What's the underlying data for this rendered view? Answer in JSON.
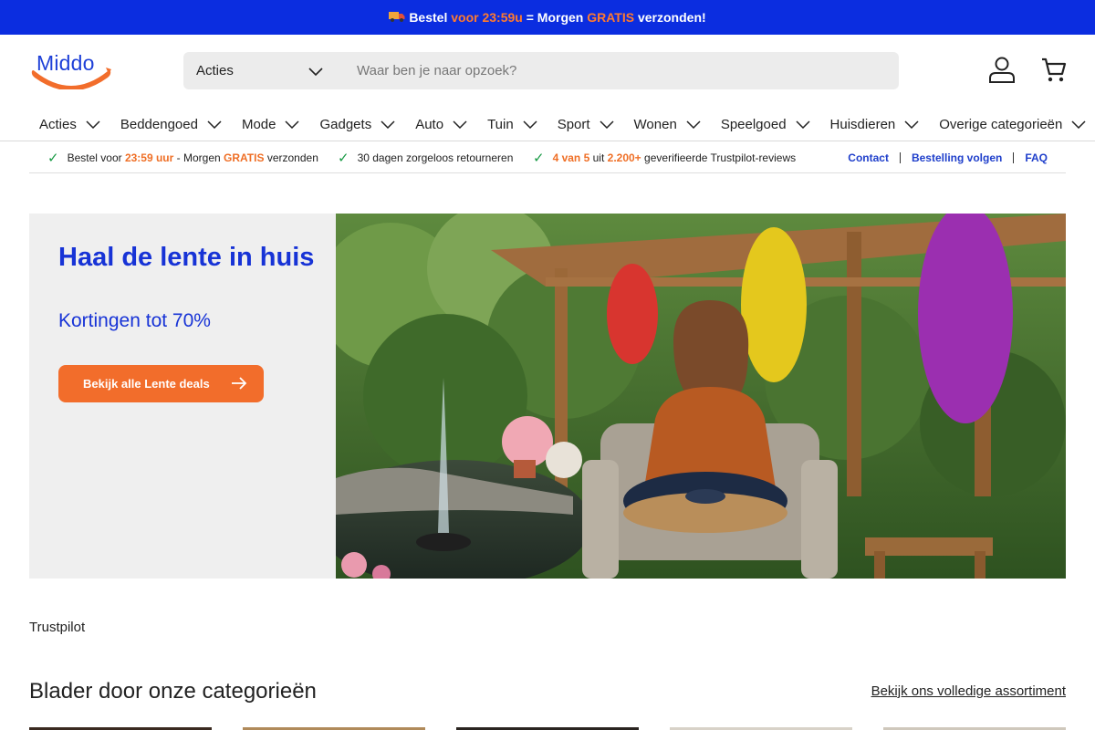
{
  "announcement": {
    "icon": "truck-icon",
    "part1": "Bestel",
    "part2": "voor 23:59u",
    "part3": "= Morgen",
    "part4": "GRATIS",
    "part5": "verzonden!"
  },
  "header": {
    "logo_text": "Middo",
    "search": {
      "category": "Acties",
      "placeholder": "Waar ben je naar opzoek?"
    }
  },
  "nav": {
    "items": [
      {
        "label": "Acties"
      },
      {
        "label": "Beddengoed"
      },
      {
        "label": "Mode"
      },
      {
        "label": "Gadgets"
      },
      {
        "label": "Auto"
      },
      {
        "label": "Tuin"
      },
      {
        "label": "Sport"
      },
      {
        "label": "Wonen"
      },
      {
        "label": "Speelgoed"
      },
      {
        "label": "Huisdieren"
      },
      {
        "label": "Overige categorieën"
      }
    ]
  },
  "usp": {
    "item1": {
      "a": "Bestel voor",
      "b": "23:59 uur",
      "c": "- Morgen",
      "d": "GRATIS",
      "e": "verzonden"
    },
    "item2": {
      "a": "30 dagen zorgeloos retourneren"
    },
    "item3": {
      "a": "4 van 5",
      "b": "uit",
      "c": "2.200+",
      "d": "geverifieerde Trustpilot-reviews"
    },
    "links": [
      "Contact",
      "Bestelling volgen",
      "FAQ"
    ]
  },
  "hero": {
    "title": "Haal de lente in huis",
    "subtitle": "Kortingen tot 70%",
    "button_label": "Bekijk alle Lente deals"
  },
  "trustpilot_label": "Trustpilot",
  "categories": {
    "title": "Blader door onze categorieën",
    "link": "Bekijk ons volledige assortiment"
  },
  "colors": {
    "brand_blue": "#1733d6",
    "announce_blue": "#0b2de0",
    "accent_orange": "#f26d2b",
    "check_green": "#1a9b46"
  }
}
